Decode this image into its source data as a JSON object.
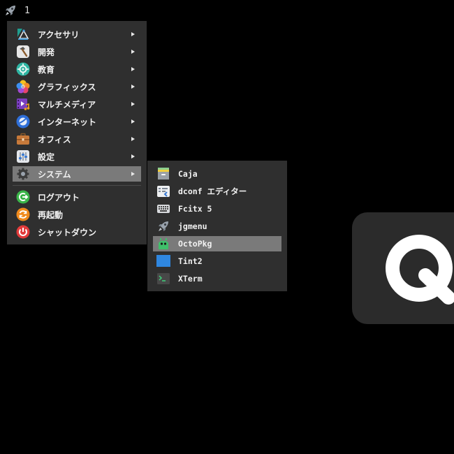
{
  "panel": {
    "launcher_icon": "rocket-icon",
    "desktop_number": "1"
  },
  "main_menu": {
    "items": [
      {
        "label": "アクセサリ",
        "icon": "accessories-icon",
        "has_submenu": true
      },
      {
        "label": "開発",
        "icon": "development-icon",
        "has_submenu": true
      },
      {
        "label": "教育",
        "icon": "education-icon",
        "has_submenu": true
      },
      {
        "label": "グラフィックス",
        "icon": "graphics-icon",
        "has_submenu": true
      },
      {
        "label": "マルチメディア",
        "icon": "multimedia-icon",
        "has_submenu": true
      },
      {
        "label": "インターネット",
        "icon": "internet-icon",
        "has_submenu": true
      },
      {
        "label": "オフィス",
        "icon": "office-icon",
        "has_submenu": true
      },
      {
        "label": "設定",
        "icon": "settings-icon",
        "has_submenu": true
      },
      {
        "label": "システム",
        "icon": "system-icon",
        "has_submenu": true,
        "selected": true
      }
    ],
    "actions": [
      {
        "label": "ログアウト",
        "icon": "logout-icon"
      },
      {
        "label": "再起動",
        "icon": "restart-icon"
      },
      {
        "label": "シャットダウン",
        "icon": "shutdown-icon"
      }
    ]
  },
  "system_submenu": {
    "items": [
      {
        "label": "Caja",
        "icon": "file-manager-icon"
      },
      {
        "label": "dconf エディター",
        "icon": "dconf-editor-icon"
      },
      {
        "label": "Fcitx 5",
        "icon": "keyboard-icon"
      },
      {
        "label": "jgmenu",
        "icon": "rocket-icon"
      },
      {
        "label": "OctoPkg",
        "icon": "octopkg-icon",
        "selected": true
      },
      {
        "label": "Tint2",
        "icon": "tint2-icon"
      },
      {
        "label": "XTerm",
        "icon": "terminal-icon"
      }
    ]
  },
  "colors": {
    "menu_background": "#2f2f2f",
    "selected_background": "#7a7a7a",
    "text": "#f2f2f2",
    "desktop": "#000000"
  }
}
